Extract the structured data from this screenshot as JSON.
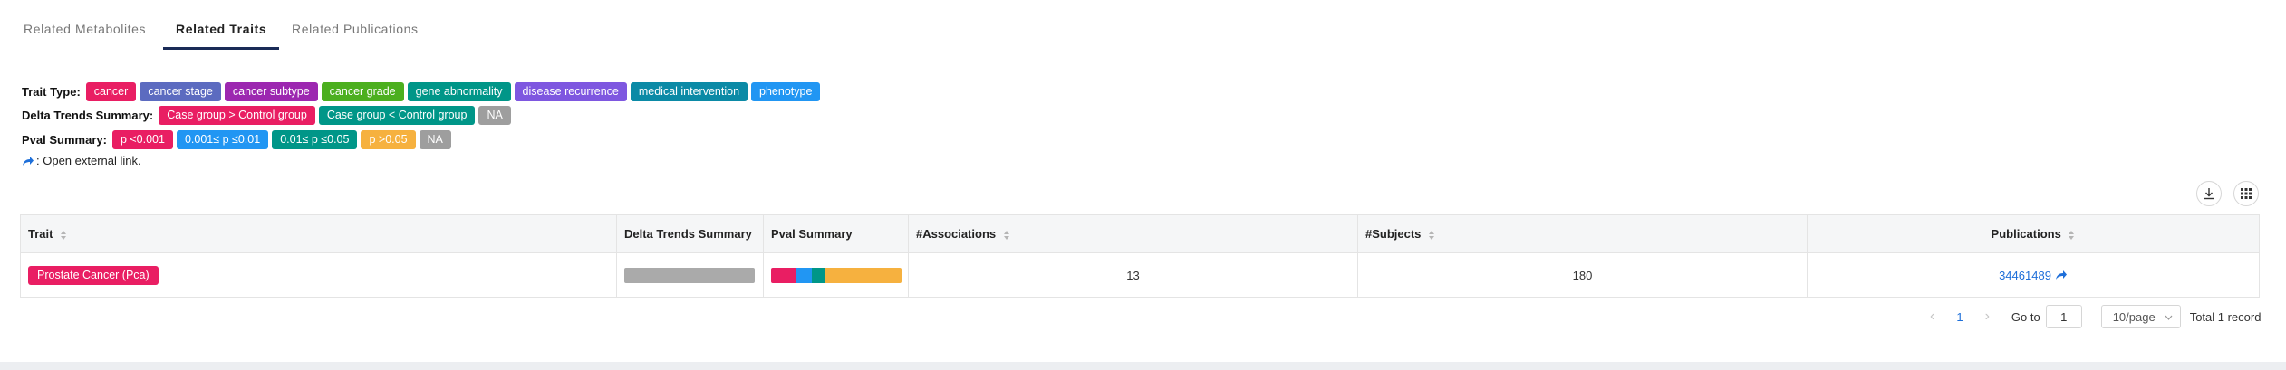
{
  "tabs": [
    {
      "label": "Related Metabolites",
      "active": false
    },
    {
      "label": "Related Traits",
      "active": true
    },
    {
      "label": "Related Publications",
      "active": false
    }
  ],
  "legend": {
    "trait_type": {
      "label": "Trait Type:",
      "tags": [
        {
          "text": "cancer",
          "color": "#e91e63"
        },
        {
          "text": "cancer stage",
          "color": "#5c6bc0"
        },
        {
          "text": "cancer subtype",
          "color": "#9c27b0"
        },
        {
          "text": "cancer grade",
          "color": "#4caf1f"
        },
        {
          "text": "gene abnormality",
          "color": "#009688"
        },
        {
          "text": "disease recurrence",
          "color": "#7e57e0"
        },
        {
          "text": "medical intervention",
          "color": "#0b8aa6"
        },
        {
          "text": "phenotype",
          "color": "#2196f3"
        }
      ]
    },
    "delta_trends": {
      "label": "Delta Trends Summary:",
      "tags": [
        {
          "text": "Case group > Control group",
          "color": "#e91e63"
        },
        {
          "text": "Case group < Control group",
          "color": "#009688"
        },
        {
          "text": "NA",
          "color": "#9e9e9e"
        }
      ]
    },
    "pval": {
      "label": "Pval Summary:",
      "tags": [
        {
          "text": "p <0.001",
          "color": "#e91e63"
        },
        {
          "text": "0.001≤ p ≤0.01",
          "color": "#2196f3"
        },
        {
          "text": "0.01≤ p ≤0.05",
          "color": "#009688"
        },
        {
          "text": "p >0.05",
          "color": "#f6b13f"
        },
        {
          "text": "NA",
          "color": "#9e9e9e"
        }
      ]
    },
    "external_note": ": Open external link."
  },
  "table": {
    "columns": [
      "Trait",
      "Delta Trends Summary",
      "Pval Summary",
      "#Associations",
      "#Subjects",
      "Publications"
    ],
    "rows": [
      {
        "trait": "Prostate Cancer (Pca)",
        "delta_bar": [
          {
            "fraction": 1.0,
            "color": "#aaaaaa"
          }
        ],
        "pval_bar": [
          {
            "fraction": 0.19,
            "color": "#e91e63"
          },
          {
            "fraction": 0.12,
            "color": "#2196f3"
          },
          {
            "fraction": 0.1,
            "color": "#009688"
          },
          {
            "fraction": 0.59,
            "color": "#f6b13f"
          }
        ],
        "associations": "13",
        "subjects": "180",
        "publication": "34461489"
      }
    ]
  },
  "pagination": {
    "current_page": "1",
    "goto_label": "Go to",
    "goto_value": "1",
    "page_size": "10/page",
    "total": "Total 1 record"
  }
}
